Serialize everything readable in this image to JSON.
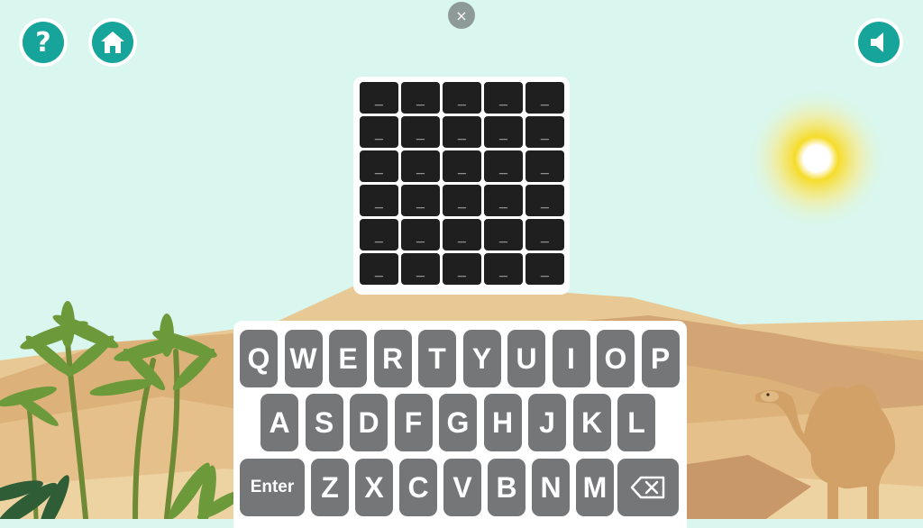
{
  "toolbar": {
    "help_label": "?",
    "close_label": "×"
  },
  "board": {
    "rows": [
      [
        "_",
        "_",
        "_",
        "_",
        "_"
      ],
      [
        "_",
        "_",
        "_",
        "_",
        "_"
      ],
      [
        "_",
        "_",
        "_",
        "_",
        "_"
      ],
      [
        "_",
        "_",
        "_",
        "_",
        "_"
      ],
      [
        "_",
        "_",
        "_",
        "_",
        "_"
      ],
      [
        "_",
        "_",
        "_",
        "_",
        "_"
      ]
    ]
  },
  "keyboard": {
    "row1": [
      "Q",
      "W",
      "E",
      "R",
      "T",
      "Y",
      "U",
      "I",
      "O",
      "P"
    ],
    "row2": [
      "A",
      "S",
      "D",
      "F",
      "G",
      "H",
      "J",
      "K",
      "L"
    ],
    "row3": [
      "Z",
      "X",
      "C",
      "V",
      "B",
      "N",
      "M"
    ],
    "enter_label": "Enter",
    "backspace_icon": "backspace-icon"
  },
  "colors": {
    "sky": "#d9f7ef",
    "accent": "#17a49a",
    "tile": "#1f1f1f",
    "key": "#757678",
    "sand": "#e8c996",
    "sun": "#f4d21b"
  },
  "icons": [
    "question-icon",
    "home-icon",
    "speaker-icon",
    "close-icon",
    "backspace-icon"
  ]
}
